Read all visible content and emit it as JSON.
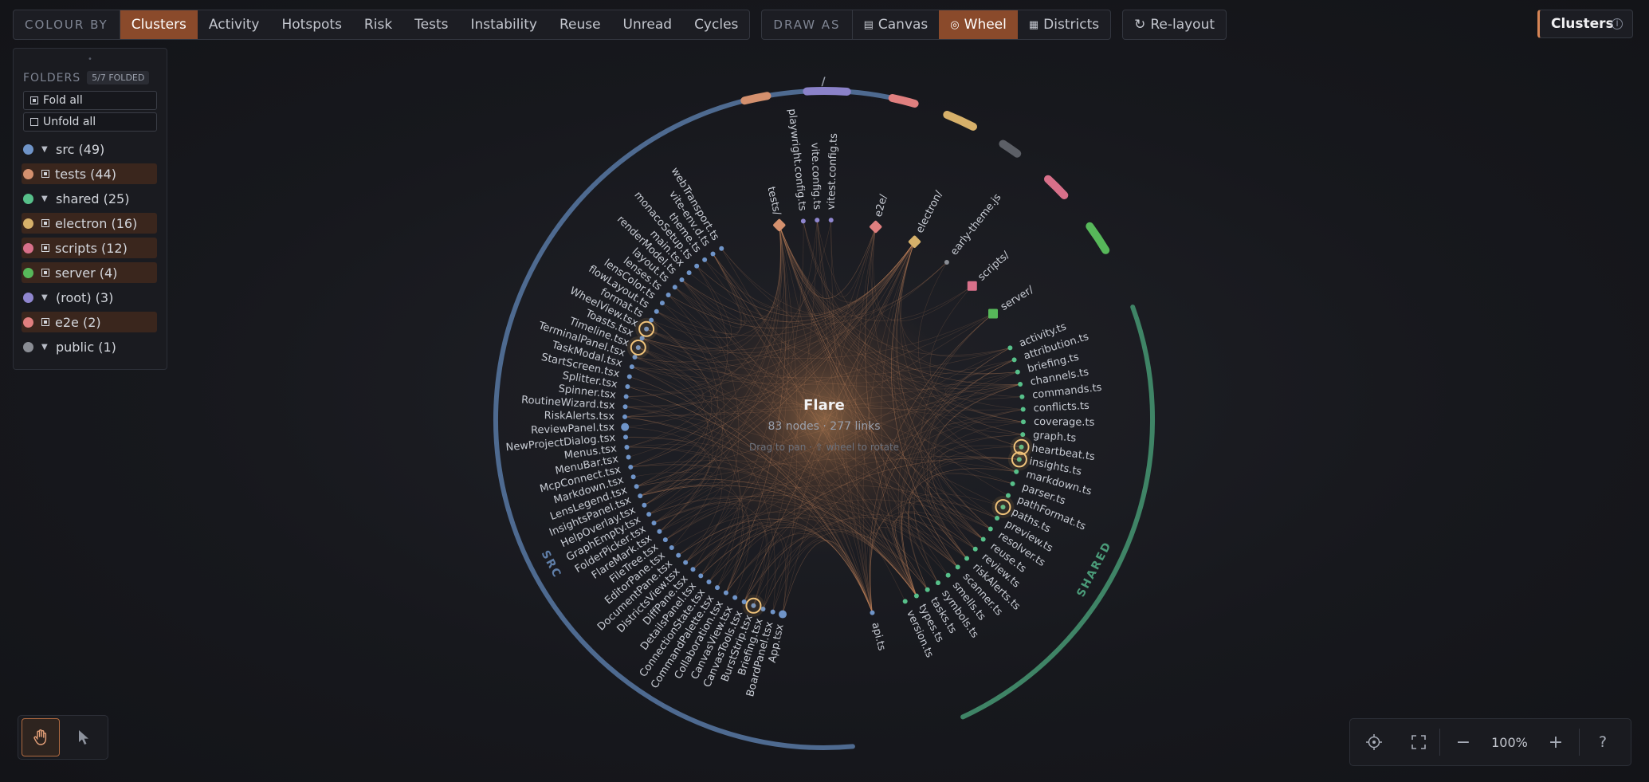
{
  "toolbar": {
    "colour_by": {
      "label": "COLOUR BY",
      "options": [
        "Clusters",
        "Activity",
        "Hotspots",
        "Risk",
        "Tests",
        "Instability",
        "Reuse",
        "Unread",
        "Cycles"
      ],
      "selected": "Clusters"
    },
    "draw_as": {
      "label": "DRAW AS",
      "options": [
        {
          "label": "Canvas",
          "icon": "table-icon"
        },
        {
          "label": "Wheel",
          "icon": "wheel-icon"
        },
        {
          "label": "Districts",
          "icon": "grid-icon"
        }
      ],
      "selected": "Wheel"
    },
    "relayout": {
      "label": "Re-layout",
      "icon": "refresh-icon"
    }
  },
  "mode_chip": {
    "label": "Clusters",
    "icon": "info-icon"
  },
  "folders": {
    "title": "FOLDERS",
    "folded_count": "5/7 FOLDED",
    "fold_all": "Fold all",
    "unfold_all": "Unfold all",
    "items": [
      {
        "label": "src (49)",
        "color": "#6f94c8",
        "state": "expanded"
      },
      {
        "label": "tests (44)",
        "color": "#d4906e",
        "state": "folded"
      },
      {
        "label": "shared (25)",
        "color": "#57c08a",
        "state": "expanded"
      },
      {
        "label": "electron (16)",
        "color": "#d6b06a",
        "state": "folded"
      },
      {
        "label": "scripts (12)",
        "color": "#d8708a",
        "state": "folded"
      },
      {
        "label": "server (4)",
        "color": "#57b85a",
        "state": "folded"
      },
      {
        "label": "(root) (3)",
        "color": "#8f86cf",
        "state": "expanded"
      },
      {
        "label": "e2e (2)",
        "color": "#e07f7f",
        "state": "folded"
      },
      {
        "label": "public (1)",
        "color": "#8a8d94",
        "state": "expanded"
      }
    ]
  },
  "graph": {
    "title": "Flare",
    "stats": "83 nodes · 277 links",
    "hint": "Drag to pan · ⇧ wheel to rotate",
    "sections": {
      "src": "SRC",
      "shared": "SHARED",
      "root": "/"
    },
    "src_nodes": [
      "App.tsx",
      "BoardPanel.tsx",
      "Briefing.tsx",
      "BurstStrip.tsx",
      "CanvasTools.tsx",
      "CanvasView.tsx",
      "Collaboration.tsx",
      "CommandPalette.tsx",
      "ConnectionState.tsx",
      "DetailsPanel.tsx",
      "DiffPane.tsx",
      "DistrictsView.tsx",
      "DocumentPane.tsx",
      "EditorPane.tsx",
      "FileTree.tsx",
      "FlareMark.tsx",
      "FolderPicker.tsx",
      "GraphEmpty.tsx",
      "HelpOverlay.tsx",
      "InsightsPanel.tsx",
      "LensLegend.tsx",
      "Markdown.tsx",
      "McpConnect.tsx",
      "MenuBar.tsx",
      "Menus.tsx",
      "NewProjectDialog.tsx",
      "ReviewPanel.tsx",
      "RiskAlerts.tsx",
      "RoutineWizard.tsx",
      "Spinner.tsx",
      "Splitter.tsx",
      "StartScreen.tsx",
      "TaskModal.tsx",
      "TerminalPanel.tsx",
      "Timeline.tsx",
      "Toasts.tsx",
      "WheelView.tsx",
      "format.ts",
      "flowLayout.ts",
      "lensColor.ts",
      "lenses.ts",
      "layout.ts",
      "renderModel.ts",
      "main.tsx",
      "monacoSetup.ts",
      "theme.ts",
      "vite-env.d.ts",
      "webTransport.ts"
    ],
    "top_nodes": [
      "tests/",
      "playwright.config.ts",
      "vite.config.ts",
      "vitest.config.ts",
      "e2e/",
      "electron/",
      "early-theme.js",
      "scripts/",
      "server/"
    ],
    "shared_nodes": [
      "activity.ts",
      "attribution.ts",
      "briefing.ts",
      "channels.ts",
      "commands.ts",
      "conflicts.ts",
      "coverage.ts",
      "graph.ts",
      "heartbeat.ts",
      "insights.ts",
      "markdown.ts",
      "parser.ts",
      "pathFormat.ts",
      "paths.ts",
      "preview.ts",
      "resolver.ts",
      "reuse.ts",
      "review.ts",
      "riskAlerts.ts",
      "scanner.ts",
      "smells.ts",
      "symbols.ts",
      "tasks.ts",
      "types.ts",
      "version.ts"
    ],
    "bottom_nodes": [
      "api.ts"
    ]
  },
  "tools": [
    {
      "name": "pan-tool",
      "icon": "hand-icon",
      "active": true
    },
    {
      "name": "select-tool",
      "icon": "pointer-icon",
      "active": false
    }
  ],
  "zoom": {
    "level": "100%",
    "fit_icon": "crosshair-icon",
    "fullscreen_icon": "expand-icon",
    "minus": "−",
    "plus": "+",
    "help": "?"
  }
}
